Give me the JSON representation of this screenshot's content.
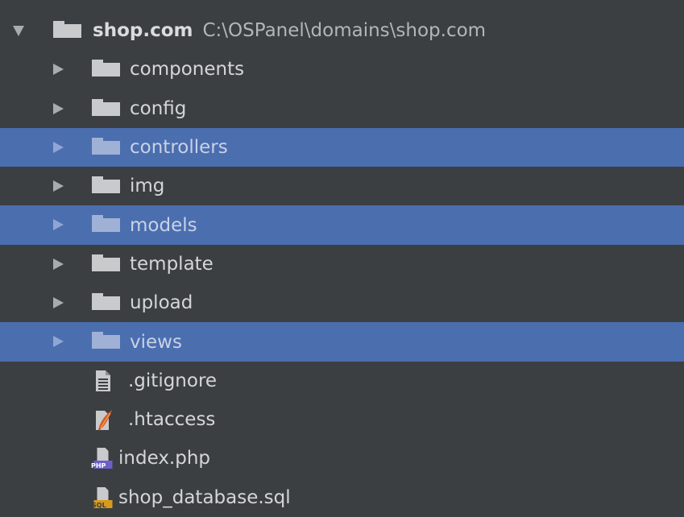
{
  "tree": {
    "root": {
      "name": "shop.com",
      "path": "C:\\OSPanel\\domains\\shop.com",
      "expanded": true,
      "icon": "folder-icon"
    },
    "folders": [
      {
        "label": "components",
        "selected": false,
        "icon": "folder-icon"
      },
      {
        "label": "config",
        "selected": false,
        "icon": "folder-icon"
      },
      {
        "label": "controllers",
        "selected": true,
        "icon": "folder-icon"
      },
      {
        "label": "img",
        "selected": false,
        "icon": "folder-icon"
      },
      {
        "label": "models",
        "selected": true,
        "icon": "folder-icon"
      },
      {
        "label": "template",
        "selected": false,
        "icon": "folder-icon"
      },
      {
        "label": "upload",
        "selected": false,
        "icon": "folder-icon"
      },
      {
        "label": "views",
        "selected": true,
        "icon": "folder-icon"
      }
    ],
    "files": [
      {
        "label": ".gitignore",
        "icon": "text-file-icon"
      },
      {
        "label": ".htaccess",
        "icon": "htaccess-feather-icon"
      },
      {
        "label": "index.php",
        "icon": "php-file-icon",
        "badge": "PHP"
      },
      {
        "label": "shop_database.sql",
        "icon": "sql-file-icon",
        "badge": "SQL"
      }
    ]
  },
  "colors": {
    "background": "#3c3f41",
    "selection": "#4b6eaf",
    "text": "#d4d6d8",
    "php_badge": "#6b5fc9",
    "sql_badge": "#d79a1c",
    "feather": "#d8552d"
  }
}
